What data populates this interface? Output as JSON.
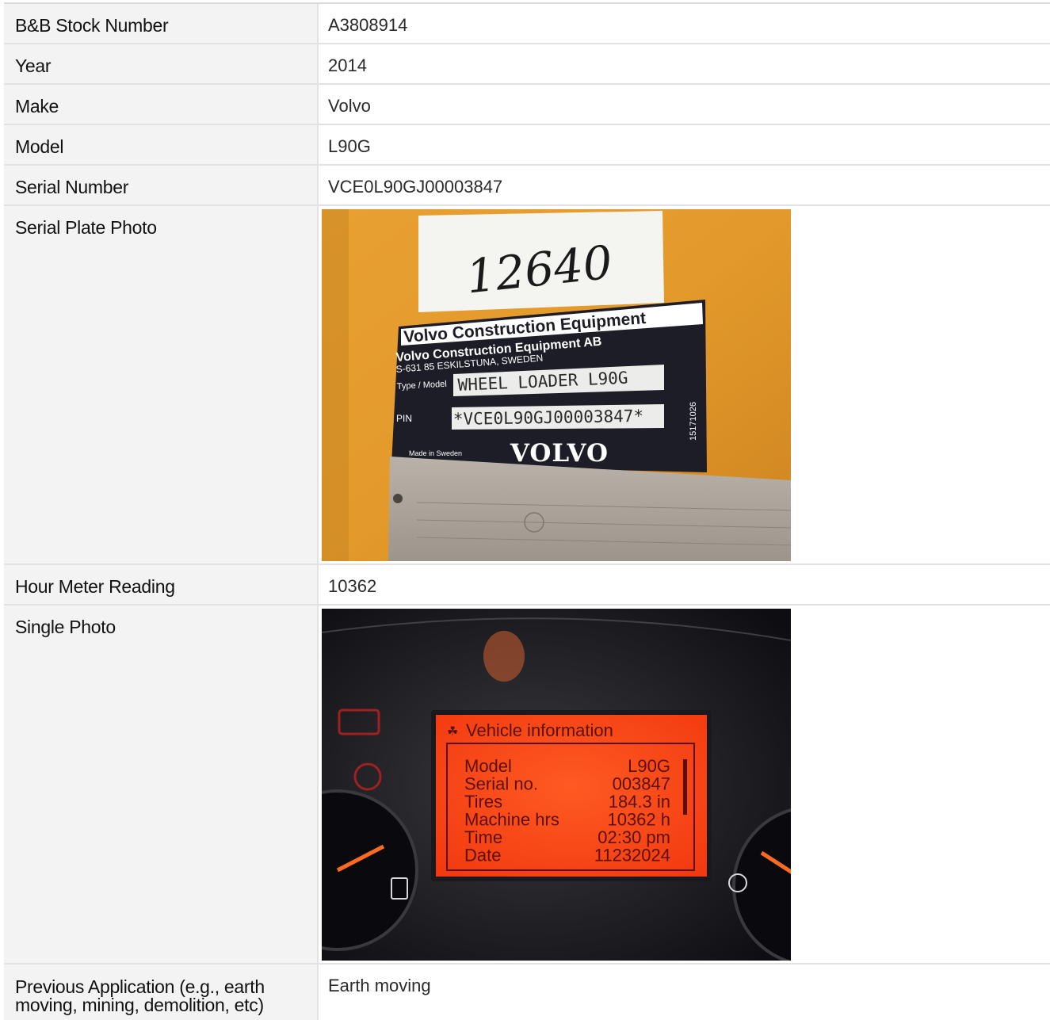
{
  "rows": [
    {
      "label": "B&B Stock Number",
      "value": "A3808914"
    },
    {
      "label": "Year",
      "value": "2014"
    },
    {
      "label": "Make",
      "value": "Volvo"
    },
    {
      "label": "Model",
      "value": "L90G"
    },
    {
      "label": "Serial Number",
      "value": "VCE0L90GJ00003847"
    },
    {
      "label": "Serial Plate Photo"
    },
    {
      "label": "Hour Meter Reading",
      "value": "10362"
    },
    {
      "label": "Single Photo"
    },
    {
      "label": "Previous Application (e.g., earth moving, mining, demolition, etc)",
      "value": "Earth moving"
    }
  ],
  "serial_plate": {
    "sticker": "12640",
    "brand_line": "Volvo Construction Equipment",
    "company": "Volvo Construction Equipment AB",
    "address": "S-631 85 ESKILSTUNA, SWEDEN",
    "type_label": "Type / Model",
    "type_value": "WHEEL LOADER L90G",
    "pin_label": "PIN",
    "pin_value": "*VCE0L90GJ00003847*",
    "made_in": "Made in Sweden",
    "logo": "VOLVO",
    "side_number": "15171026"
  },
  "dashboard": {
    "title": "Vehicle information",
    "lines": [
      {
        "k": "Model",
        "v": "L90G"
      },
      {
        "k": "Serial no.",
        "v": "003847"
      },
      {
        "k": "Tires",
        "v": "184.3 in"
      },
      {
        "k": "Machine hrs",
        "v": "10362 h"
      },
      {
        "k": "Time",
        "v": "02:30 pm"
      },
      {
        "k": "Date",
        "v": "11232024"
      }
    ]
  },
  "colors": {
    "plate_bg": "#e59a2a",
    "plate_dark": "#1d1d28",
    "screen": "#ff4a18",
    "screen_text": "#5a1004"
  }
}
